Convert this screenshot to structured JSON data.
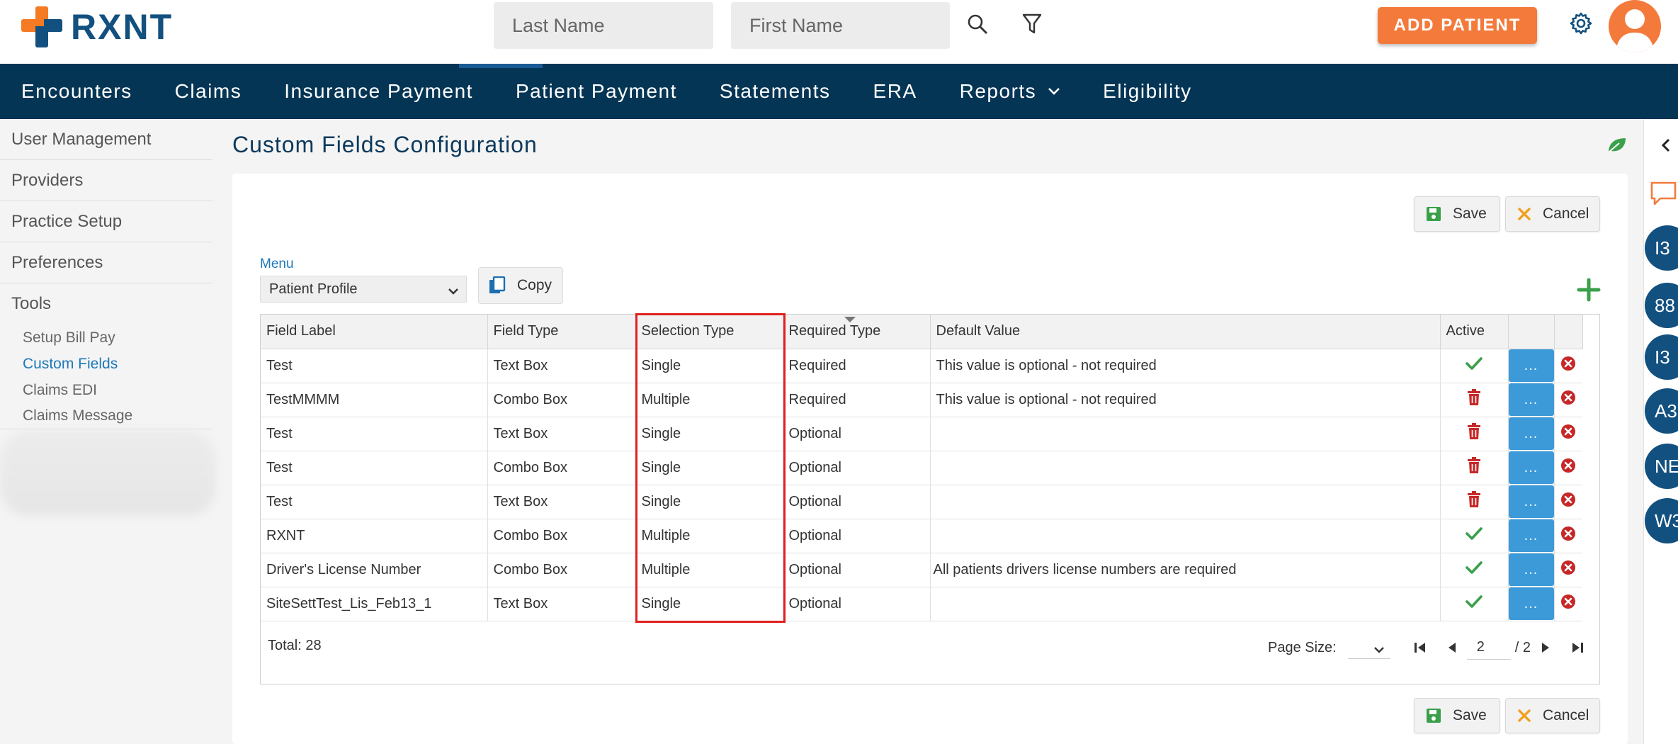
{
  "app": {
    "logo_text": "RXNT",
    "brand_orange": "#f47a24",
    "brand_blue": "#12507f",
    "nav_bg": "#053555"
  },
  "header": {
    "last_name_placeholder": "Last Name",
    "first_name_placeholder": "First Name",
    "search_icon": "search-icon",
    "filter_icon": "filter-icon",
    "add_patient_label": "ADD PATIENT",
    "settings_icon": "gear-icon",
    "avatar_icon": "user-avatar"
  },
  "nav": {
    "items": [
      "Encounters",
      "Claims",
      "Insurance Payment",
      "Patient Payment",
      "Statements",
      "ERA",
      "Reports",
      "Eligibility"
    ]
  },
  "sidebar": {
    "items": [
      "User Management",
      "Providers",
      "Practice Setup",
      "Preferences",
      "Tools"
    ],
    "sub_items": [
      "Setup Bill Pay",
      "Custom Fields",
      "Claims EDI",
      "Claims Message"
    ],
    "active_sub": "Custom Fields"
  },
  "main": {
    "title": "Custom Fields Configuration",
    "save_label": "Save",
    "cancel_label": "Cancel",
    "menu_label": "Menu",
    "menu_value": "Patient Profile",
    "copy_label": "Copy"
  },
  "table": {
    "headers": [
      "Field Label",
      "Field Type",
      "Selection Type",
      "Required Type",
      "Default Value",
      "Active"
    ],
    "rows": [
      {
        "label": "Test",
        "type": "Text Box",
        "selection": "Single",
        "required": "Required",
        "default": "This value is optional - not required",
        "active_icon": "check-icon"
      },
      {
        "label": "TestMMMM",
        "type": "Combo Box",
        "selection": "Multiple",
        "required": "Required",
        "default": "This value is optional - not required",
        "active_icon": "trash-icon"
      },
      {
        "label": "Test",
        "type": "Text Box",
        "selection": "Single",
        "required": "Optional",
        "default": "",
        "active_icon": "trash-icon"
      },
      {
        "label": "Test",
        "type": "Combo Box",
        "selection": "Single",
        "required": "Optional",
        "default": "",
        "active_icon": "trash-icon"
      },
      {
        "label": "Test",
        "type": "Text Box",
        "selection": "Single",
        "required": "Optional",
        "default": "",
        "active_icon": "trash-icon"
      },
      {
        "label": "RXNT",
        "type": "Combo Box",
        "selection": "Multiple",
        "required": "Optional",
        "default": "",
        "active_icon": "check-icon"
      },
      {
        "label": "Driver's License Number",
        "type": "Combo Box",
        "selection": "Multiple",
        "required": "Optional",
        "default": "All patients drivers license numbers are required",
        "active_icon": "check-icon"
      },
      {
        "label": "SiteSettTest_Lis_Feb13_1",
        "type": "Text Box",
        "selection": "Single",
        "required": "Optional",
        "default": "",
        "active_icon": "check-icon"
      }
    ],
    "dots_label": "...",
    "check_color": "#3aa04a",
    "trash_color": "#c62828",
    "remove_color": "#c62828"
  },
  "footer": {
    "total_label": "Total: 28",
    "page_size_label": "Page Size:",
    "page_value": "2",
    "page_of": "/ 2"
  },
  "rail": {
    "bubbles": [
      "I3",
      "88",
      "I3",
      "A3",
      "NE",
      "W3"
    ]
  }
}
